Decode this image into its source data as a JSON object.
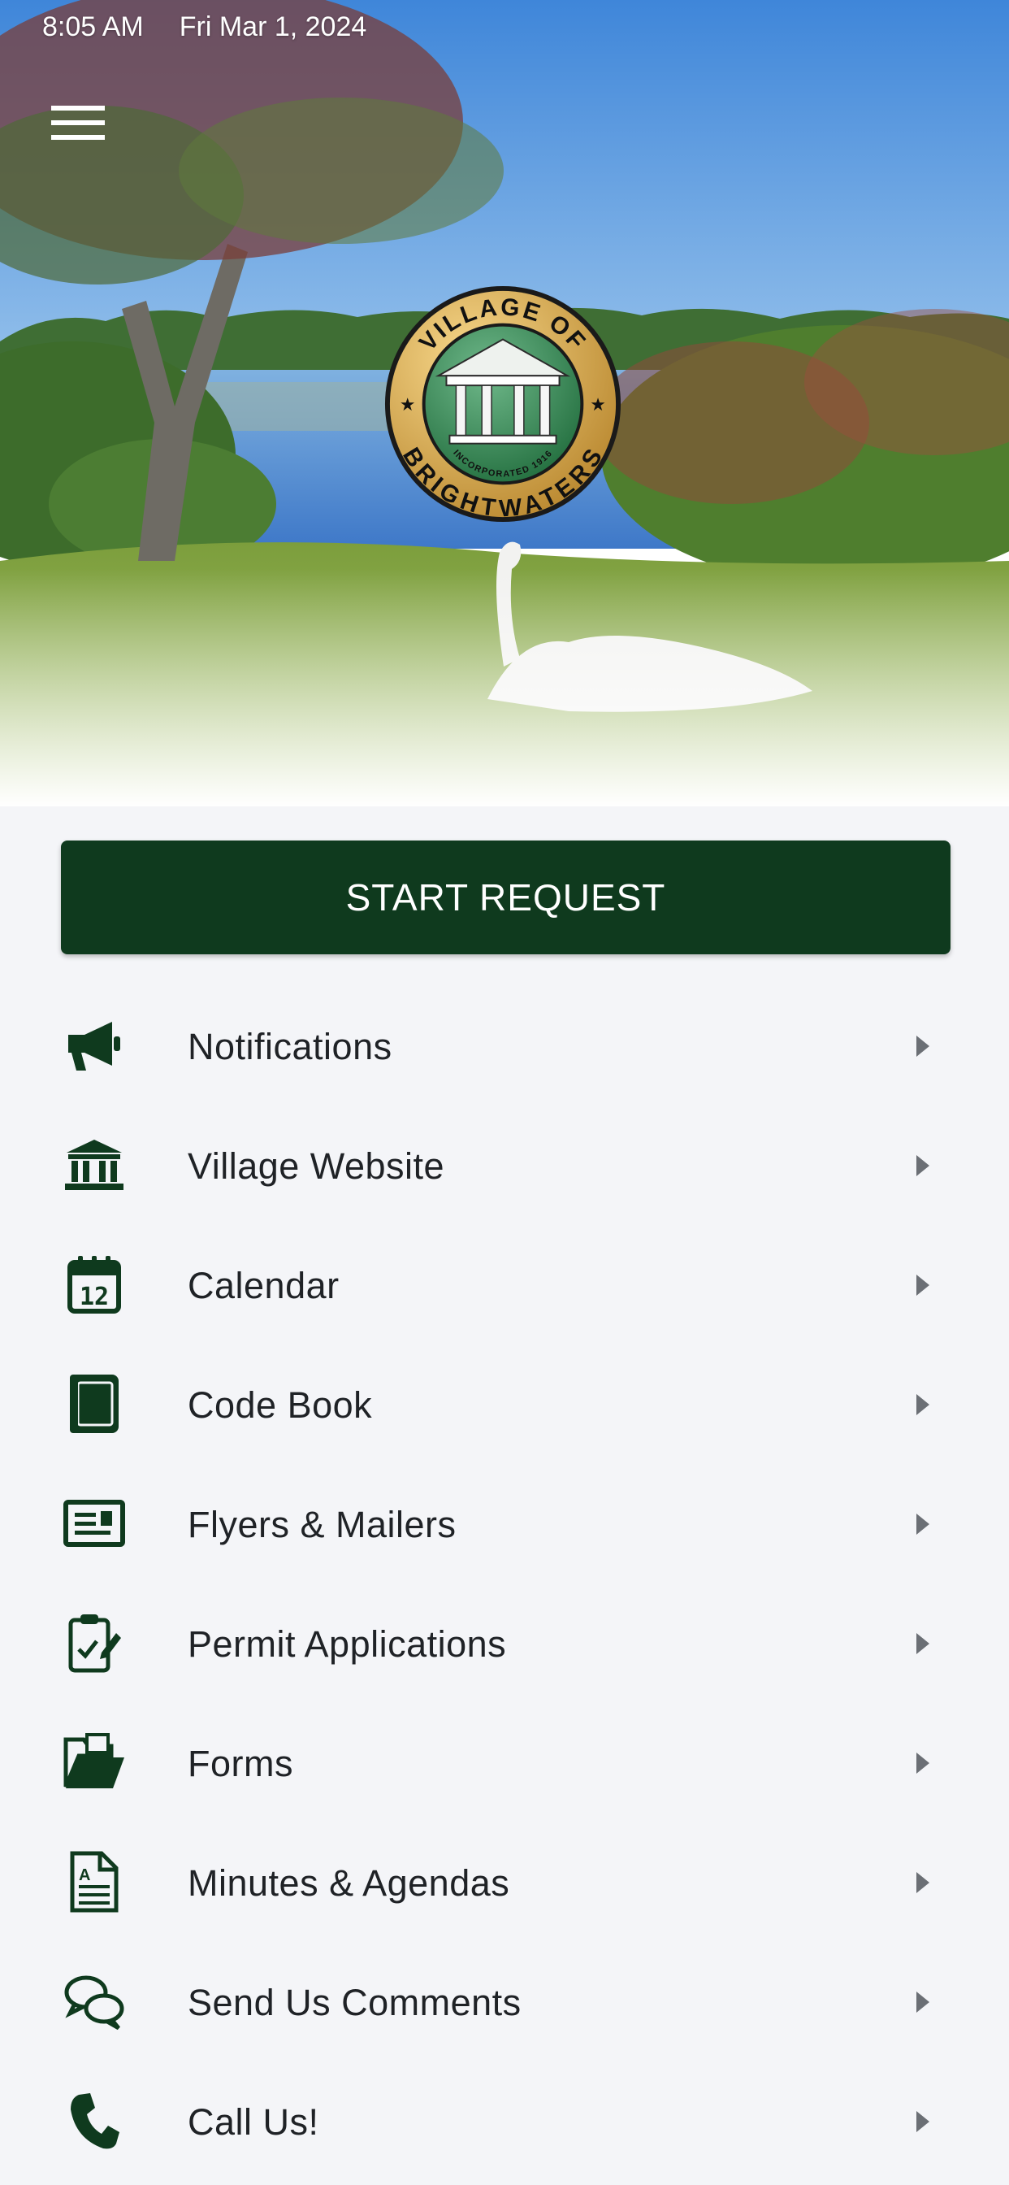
{
  "status_bar": {
    "time": "8:05 AM",
    "date": "Fri Mar 1, 2024"
  },
  "header": {
    "menu_icon": "hamburger-menu-icon"
  },
  "seal": {
    "top_text": "VILLAGE OF",
    "bottom_text": "BRIGHTWATERS",
    "inner_text": "INCORPORATED 1916"
  },
  "start_request": {
    "label": "START REQUEST"
  },
  "menu": {
    "items": [
      {
        "label": "Notifications",
        "icon": "megaphone-icon"
      },
      {
        "label": "Village Website",
        "icon": "building-icon"
      },
      {
        "label": "Calendar",
        "icon": "calendar-icon"
      },
      {
        "label": "Code Book",
        "icon": "book-icon"
      },
      {
        "label": "Flyers & Mailers",
        "icon": "newspaper-icon"
      },
      {
        "label": "Permit Applications",
        "icon": "clipboard-check-icon"
      },
      {
        "label": "Forms",
        "icon": "folder-open-icon"
      },
      {
        "label": "Minutes & Agendas",
        "icon": "document-icon"
      },
      {
        "label": "Send Us Comments",
        "icon": "comments-icon"
      },
      {
        "label": "Call Us!",
        "icon": "phone-icon"
      }
    ]
  },
  "colors": {
    "accent": "#0f3a1e",
    "icon": "#0f3a1e",
    "background": "#f4f5f8",
    "text": "#1f2226",
    "chevron": "#6b6f75"
  }
}
